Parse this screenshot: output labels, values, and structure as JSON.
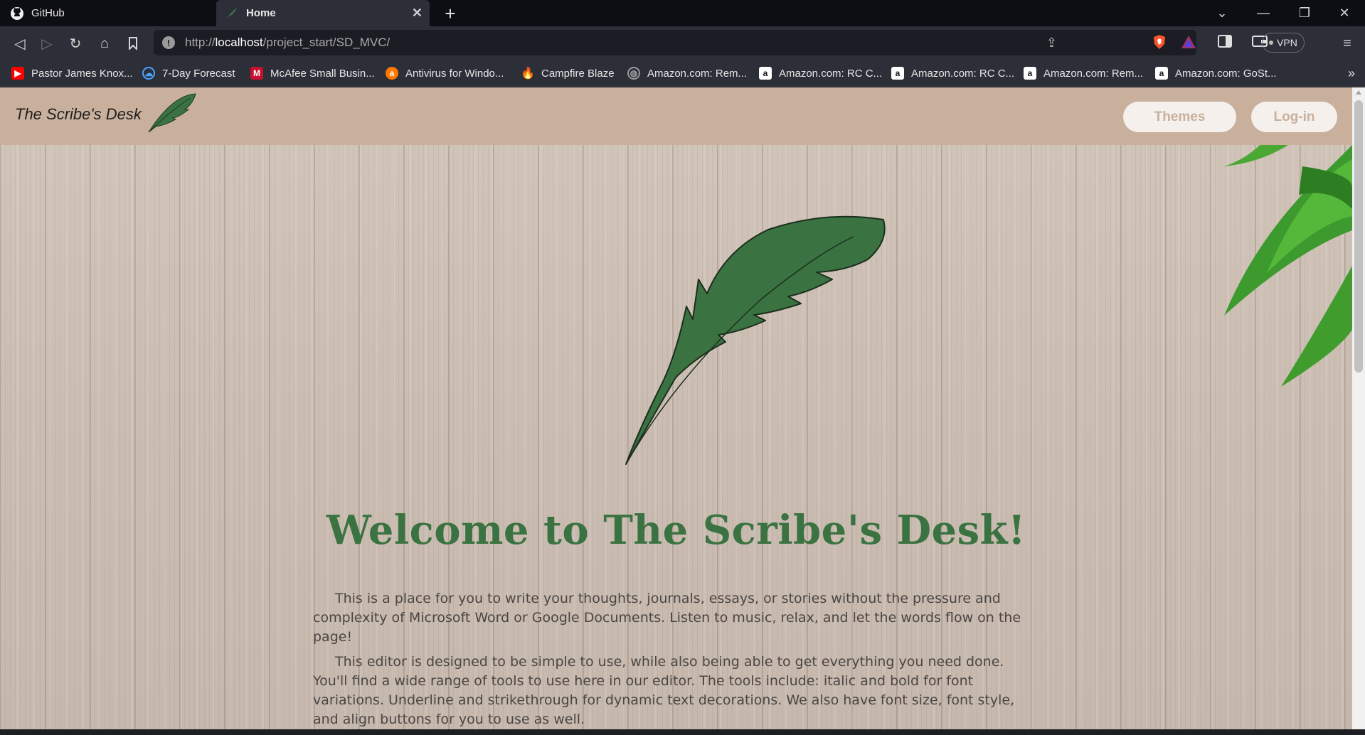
{
  "browser": {
    "tabs": [
      {
        "title": "GitHub",
        "icon": "github-icon"
      },
      {
        "title": "Home",
        "icon": "quill-icon",
        "active": true
      }
    ],
    "url": {
      "scheme": "http://",
      "host": "localhost",
      "path": "/project_start/SD_MVC/"
    },
    "vpn_label": "VPN",
    "bookmarks": [
      {
        "label": "Pastor James Knox...",
        "icon": "youtube-icon",
        "color": "#ff0000"
      },
      {
        "label": "7-Day Forecast",
        "icon": "weather-icon",
        "color": "#4aa3ff"
      },
      {
        "label": "McAfee Small Busin...",
        "icon": "mcafee-icon",
        "color": "#c8102e"
      },
      {
        "label": "Antivirus for Windo...",
        "icon": "avast-icon",
        "color": "#ff7800"
      },
      {
        "label": "Campfire Blaze",
        "icon": "flame-icon",
        "color": "#ff8a00"
      },
      {
        "label": "Amazon.com: Rem...",
        "icon": "globe-icon",
        "color": "#9a9a9a"
      },
      {
        "label": "Amazon.com: RC C...",
        "icon": "amazon-icon",
        "color": "#ffffff"
      },
      {
        "label": "Amazon.com: RC C...",
        "icon": "amazon-icon",
        "color": "#ffffff"
      },
      {
        "label": "Amazon.com: Rem...",
        "icon": "amazon-icon",
        "color": "#ffffff"
      },
      {
        "label": "Amazon.com: GoSt...",
        "icon": "amazon-icon",
        "color": "#ffffff"
      }
    ]
  },
  "site": {
    "brand": "The Scribe's Desk",
    "nav": {
      "themes": "Themes",
      "login": "Log-in"
    },
    "welcome": "Welcome to The Scribe's Desk!",
    "paragraphs": [
      "This is a place for you to write your thoughts, journals, essays, or stories without the pressure and complexity of Microsoft Word or Google Documents. Listen to music, relax, and let the words flow on the page!",
      "This editor is designed to be simple to use, while also being able to get everything you need done. You'll find a wide range of tools to use here in our editor. The tools include: italic and bold for font variations. Underline and strikethrough for dynamic text decorations. We also have font size, font style, and align buttons for you to use as well."
    ],
    "colors": {
      "header": "#c9b09d",
      "accent": "#3a7341",
      "pill_bg": "#f5f0ec"
    }
  }
}
